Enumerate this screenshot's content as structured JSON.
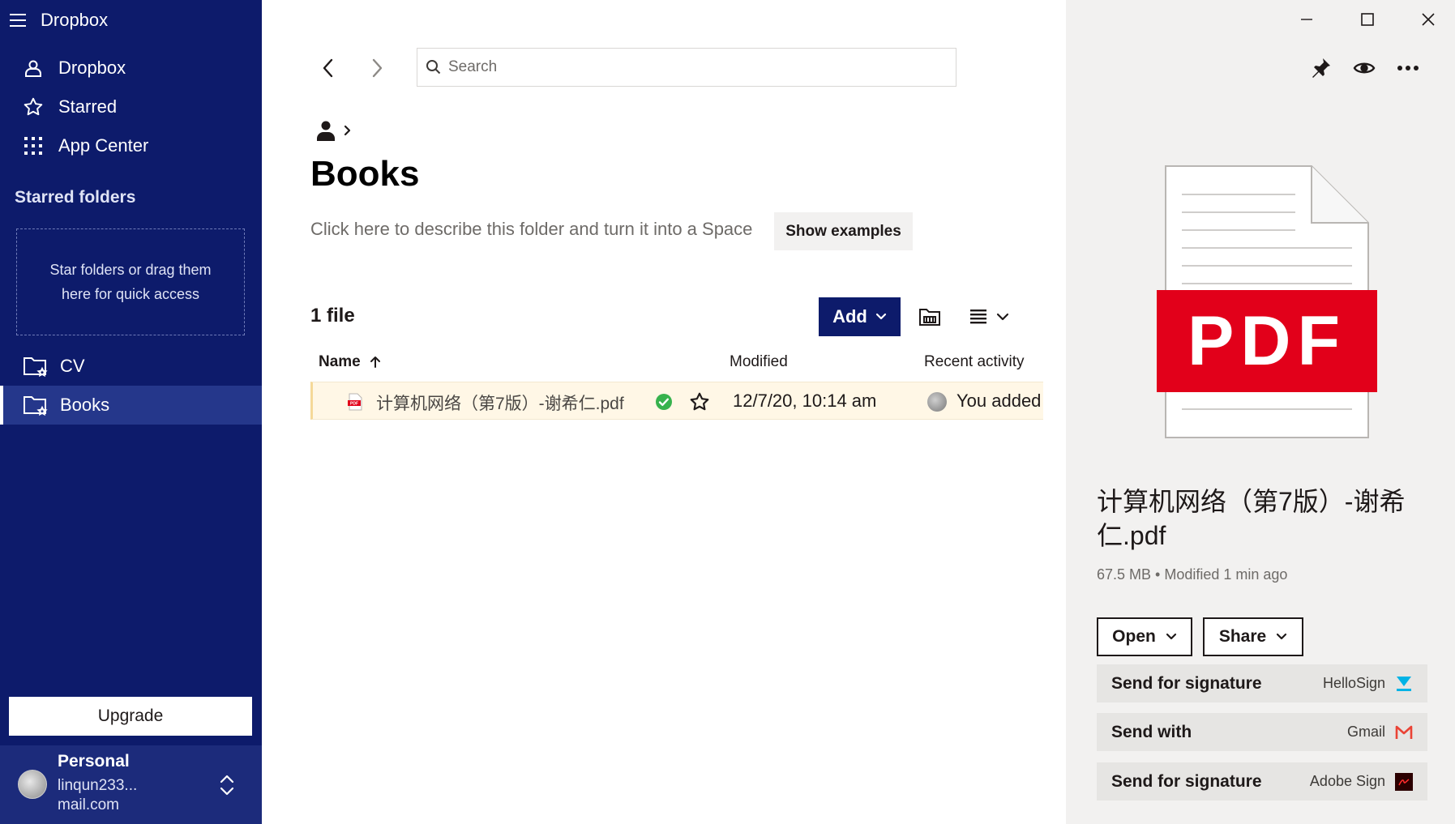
{
  "sidebar": {
    "app_title": "Dropbox",
    "nav": [
      {
        "label": "Dropbox",
        "icon": "person-icon"
      },
      {
        "label": "Starred",
        "icon": "star-icon"
      },
      {
        "label": "App Center",
        "icon": "grid-icon"
      }
    ],
    "starred_heading": "Starred folders",
    "drop_hint_line1": "Star folders or drag them",
    "drop_hint_line2": "here for quick access",
    "folders": [
      {
        "label": "CV",
        "active": false
      },
      {
        "label": "Books",
        "active": true
      }
    ],
    "upgrade_label": "Upgrade",
    "account": {
      "name": "Personal",
      "email_line1": "linqun233...",
      "email_line2": "mail.com"
    }
  },
  "main": {
    "search_placeholder": "Search",
    "page_title": "Books",
    "describe_text": "Click here to describe this folder and turn it into a Space",
    "show_examples_label": "Show examples",
    "file_count": "1 file",
    "add_label": "Add",
    "columns": {
      "name": "Name",
      "modified": "Modified",
      "recent_activity": "Recent activity"
    },
    "files": [
      {
        "name": "计算机网络（第7版）-谢希仁.pdf",
        "modified": "12/7/20, 10:14 am",
        "activity": "You added"
      }
    ]
  },
  "panel": {
    "file_name": "计算机网络（第7版）-谢希仁.pdf",
    "meta": "67.5 MB • Modified 1 min ago",
    "preview_label": "PDF",
    "open_label": "Open",
    "share_label": "Share",
    "actions": [
      {
        "label": "Send for signature",
        "service": "HelloSign"
      },
      {
        "label": "Send with",
        "service": "Gmail"
      },
      {
        "label": "Send for signature",
        "service": "Adobe Sign"
      }
    ]
  },
  "colors": {
    "sidebar_bg": "#0d1b6b",
    "accent": "#0d1b6b",
    "pdf_red": "#e2001a",
    "selected_row": "#fff7e6",
    "synced_green": "#37b24d",
    "hellosign_blue": "#00b3e6",
    "gmail_red": "#ea4335"
  }
}
